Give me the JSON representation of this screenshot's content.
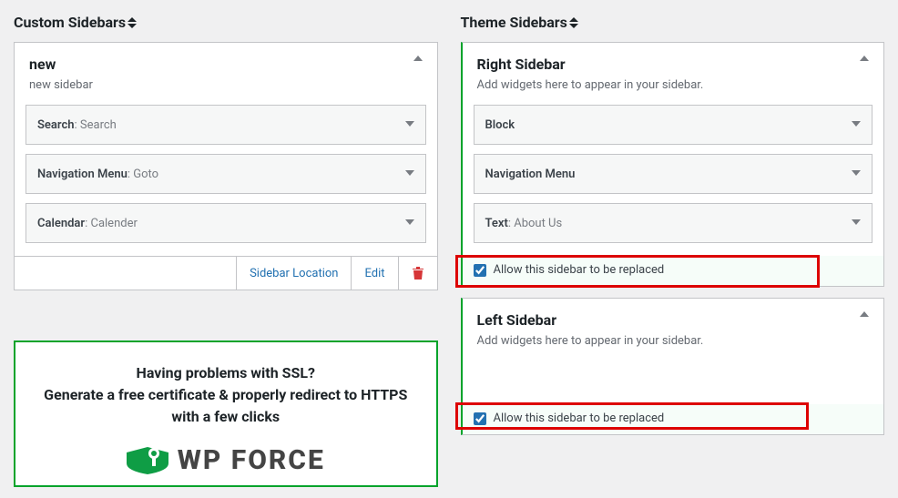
{
  "headings": {
    "custom": "Custom Sidebars",
    "theme": "Theme Sidebars"
  },
  "custom_sidebar": {
    "title": "new",
    "description": "new sidebar",
    "widgets": [
      {
        "name": "Search",
        "value": "Search"
      },
      {
        "name": "Navigation Menu",
        "value": "Goto"
      },
      {
        "name": "Calendar",
        "value": "Calender"
      }
    ],
    "actions": {
      "location": "Sidebar Location",
      "edit": "Edit"
    }
  },
  "theme_sidebars": [
    {
      "title": "Right Sidebar",
      "description": "Add widgets here to appear in your sidebar.",
      "widgets": [
        {
          "name": "Block",
          "value": ""
        },
        {
          "name": "Navigation Menu",
          "value": ""
        },
        {
          "name": "Text",
          "value": "About Us"
        }
      ],
      "allow_label": "Allow this sidebar to be replaced"
    },
    {
      "title": "Left Sidebar",
      "description": "Add widgets here to appear in your sidebar.",
      "widgets": [],
      "allow_label": "Allow this sidebar to be replaced"
    }
  ],
  "promo": {
    "line1": "Having problems with SSL?",
    "line2": "Generate a free certificate & properly redirect to HTTPS with a few clicks",
    "logo_text_partial": "WP FORCE"
  }
}
